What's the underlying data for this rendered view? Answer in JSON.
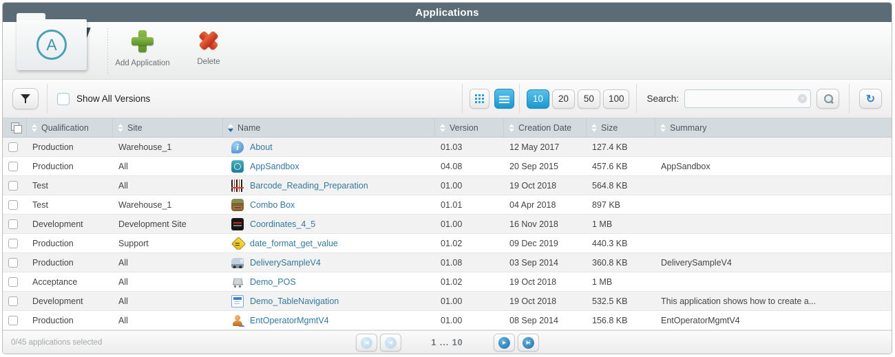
{
  "title": "Applications",
  "logo_letter": "A",
  "toolbar": {
    "add_label": "Add Application",
    "delete_label": "Delete"
  },
  "filter_bar": {
    "show_all_versions_label": "Show All Versions",
    "show_all_versions_checked": false,
    "page_sizes": [
      "10",
      "20",
      "50",
      "100"
    ],
    "active_page_size": "10",
    "active_view": "list",
    "search_label": "Search:",
    "search_value": "",
    "search_placeholder": ""
  },
  "table": {
    "columns": [
      "Qualification",
      "Site",
      "Name",
      "Version",
      "Creation Date",
      "Size",
      "Summary"
    ],
    "sorted_column": "Name",
    "rows": [
      {
        "qualification": "Production",
        "site": "Warehouse_1",
        "icon": "info",
        "name": "About",
        "version": "01.03",
        "creation_date": "12 May 2017",
        "size": "127.4 KB",
        "summary": ""
      },
      {
        "qualification": "Production",
        "site": "All",
        "icon": "sandbox",
        "name": "AppSandbox",
        "version": "04.08",
        "creation_date": "20 Sep 2015",
        "size": "457.6 KB",
        "summary": "AppSandbox"
      },
      {
        "qualification": "Test",
        "site": "All",
        "icon": "barcode",
        "name": "Barcode_Reading_Preparation",
        "version": "01.00",
        "creation_date": "19 Oct 2018",
        "size": "564.8 KB",
        "summary": ""
      },
      {
        "qualification": "Test",
        "site": "Warehouse_1",
        "icon": "combo",
        "name": "Combo Box",
        "version": "01.01",
        "creation_date": "04 Apr 2018",
        "size": "897 KB",
        "summary": ""
      },
      {
        "qualification": "Development",
        "site": "Development Site",
        "icon": "coords",
        "name": "Coordinates_4_5",
        "version": "01.00",
        "creation_date": "16 Nov 2018",
        "size": "1 MB",
        "summary": ""
      },
      {
        "qualification": "Production",
        "site": "Support",
        "icon": "roadsign",
        "name": "date_format_get_value",
        "version": "01.02",
        "creation_date": "09 Dec 2019",
        "size": "440.3 KB",
        "summary": ""
      },
      {
        "qualification": "Production",
        "site": "All",
        "icon": "truck",
        "name": "DeliverySampleV4",
        "version": "01.08",
        "creation_date": "03 Sep 2014",
        "size": "360.8 KB",
        "summary": "DeliverySampleV4"
      },
      {
        "qualification": "Acceptance",
        "site": "All",
        "icon": "cart",
        "name": "Demo_POS",
        "version": "01.02",
        "creation_date": "19 Oct 2018",
        "size": "1 MB",
        "summary": ""
      },
      {
        "qualification": "Development",
        "site": "All",
        "icon": "tablenav",
        "name": "Demo_TableNavigation",
        "version": "01.00",
        "creation_date": "19 Oct 2018",
        "size": "532.5 KB",
        "summary": "This application shows how to create a..."
      },
      {
        "qualification": "Production",
        "site": "All",
        "icon": "person",
        "name": "EntOperatorMgmtV4",
        "version": "01.00",
        "creation_date": "08 Sep 2014",
        "size": "156.8 KB",
        "summary": "EntOperatorMgmtV4"
      }
    ]
  },
  "footer": {
    "selection_text": "0/45 applications selected",
    "page_range_label": "1 ... 10"
  },
  "colors": {
    "titlebar_bg": "#5b6c77",
    "accent_blue": "#2fa8dd",
    "link_blue": "#33789e",
    "header_row_bg": "#d3dbdf",
    "alt_row_bg": "#f2f2f2",
    "add_green": "#6f9e35",
    "delete_red": "#d3432a"
  }
}
